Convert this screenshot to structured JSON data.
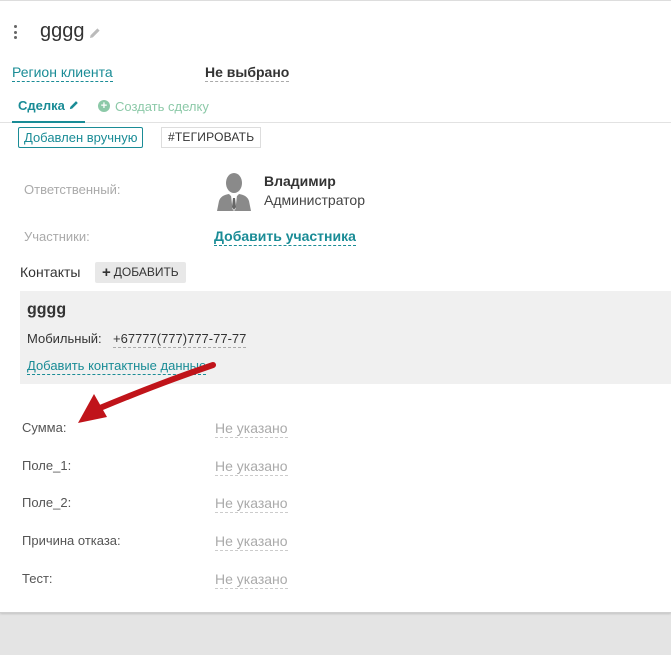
{
  "header": {
    "title": "gggg"
  },
  "region": {
    "label": "Регион клиента",
    "value": "Не выбрано"
  },
  "tabs": [
    {
      "label": "Сделка"
    },
    {
      "label": "Создать сделку"
    }
  ],
  "chips": {
    "source": "Добавлен вручную",
    "tag": "#ТЕГИРОВАТЬ"
  },
  "responsible": {
    "label": "Ответственный:",
    "name": "Владимир",
    "role": "Администратор"
  },
  "participants": {
    "label": "Участники:",
    "add_link": "Добавить участника"
  },
  "contacts": {
    "heading": "Контакты",
    "add_button": "ДОБАВИТЬ",
    "contact": {
      "name": "gggg",
      "mobile_label": "Мобильный:",
      "mobile_value": "+67777(777)777-77-77",
      "add_data_link": "Добавить контактные данные"
    }
  },
  "fields": [
    {
      "label": "Сумма:",
      "value": "Не указано"
    },
    {
      "label": "Поле_1:",
      "value": "Не указано"
    },
    {
      "label": "Поле_2:",
      "value": "Не указано"
    },
    {
      "label": "Причина отказа:",
      "value": "Не указано"
    },
    {
      "label": "Тест:",
      "value": "Не указано"
    }
  ],
  "colors": {
    "accent": "#1a8c96",
    "create_green": "#8cc9a8",
    "arrow_red": "#c0141a"
  }
}
